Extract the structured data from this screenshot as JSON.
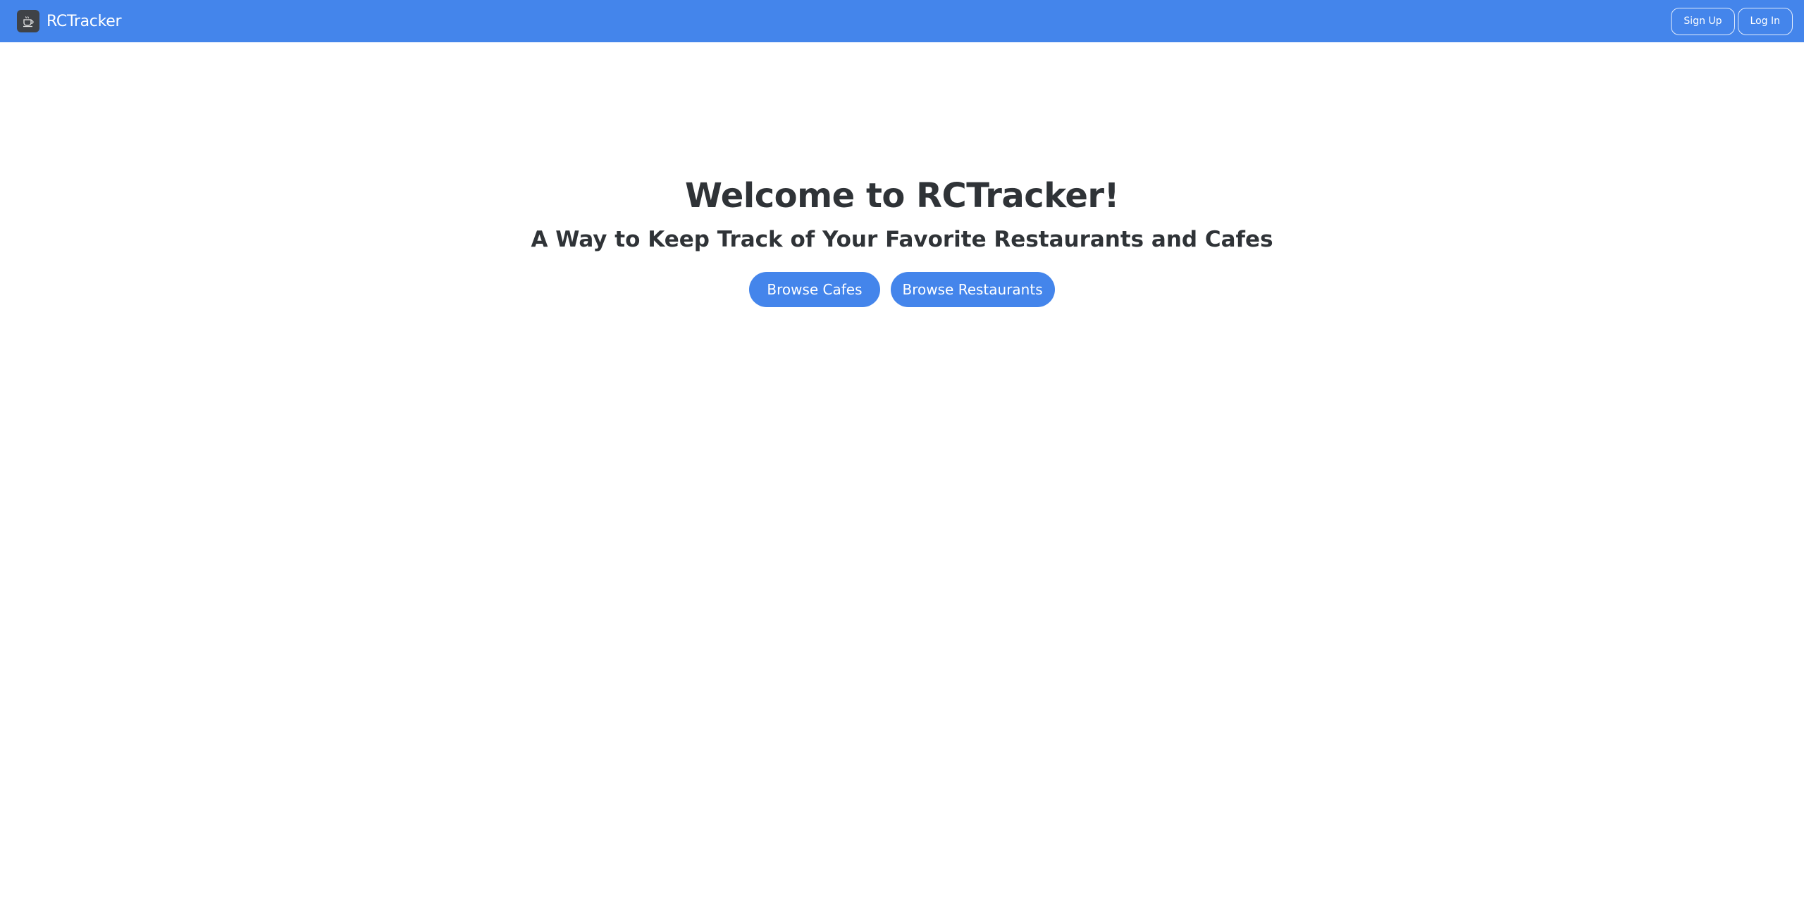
{
  "navbar": {
    "brand": "RCTracker",
    "logo_icon": "coffee-cup-icon",
    "sign_up_label": "Sign Up",
    "log_in_label": "Log In",
    "background_color": "#4485eb"
  },
  "hero": {
    "title": "Welcome to RCTracker!",
    "subtitle": "A Way to Keep Track of Your Favorite Restaurants and Cafes",
    "browse_cafes_label": "Browse Cafes",
    "browse_restaurants_label": "Browse Restaurants",
    "button_color": "#4485eb",
    "text_color": "#2f3337"
  }
}
